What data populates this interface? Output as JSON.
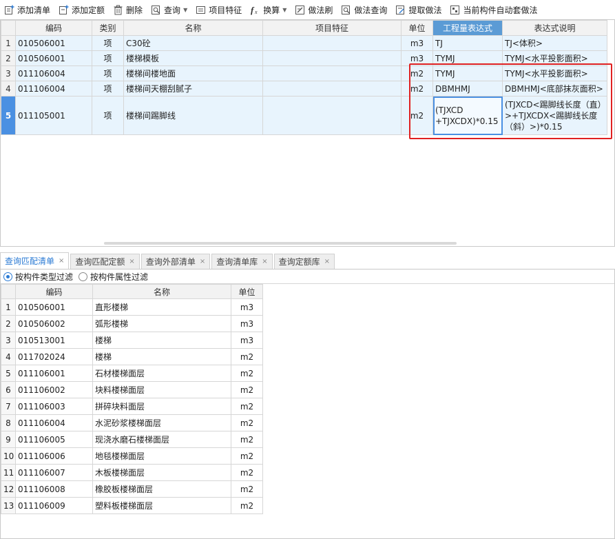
{
  "toolbar": {
    "add_list": "添加清单",
    "add_quota": "添加定额",
    "delete": "删除",
    "query": "查询",
    "item_feature": "项目特征",
    "convert": "换算",
    "method_brush": "做法刷",
    "method_query": "做法查询",
    "extract_method": "提取做法",
    "auto_apply": "当前构件自动套做法"
  },
  "upper_table": {
    "headers": [
      "编码",
      "类别",
      "名称",
      "项目特征",
      "单位",
      "工程量表达式",
      "表达式说明"
    ],
    "rows": [
      {
        "n": "1",
        "code": "010506001",
        "type": "项",
        "name": "C30砼",
        "feature": "",
        "unit": "m3",
        "expr": "TJ",
        "desc": "TJ<体积>"
      },
      {
        "n": "2",
        "code": "010506001",
        "type": "项",
        "name": "楼梯模板",
        "feature": "",
        "unit": "m3",
        "expr": "TYMJ",
        "desc": "TYMJ<水平投影面积>"
      },
      {
        "n": "3",
        "code": "011106004",
        "type": "项",
        "name": "楼梯间楼地面",
        "feature": "",
        "unit": "m2",
        "expr": "TYMJ",
        "desc": "TYMJ<水平投影面积>"
      },
      {
        "n": "4",
        "code": "011106004",
        "type": "项",
        "name": "楼梯间天棚刮腻子",
        "feature": "",
        "unit": "m2",
        "expr": "DBMHMJ",
        "desc": "DBMHMJ<底部抹灰面积>"
      },
      {
        "n": "5",
        "code": "011105001",
        "type": "项",
        "name": "楼梯间踢脚线",
        "feature": "",
        "unit": "m2",
        "expr": "(TJXCD +TJXCDX)*0.15",
        "desc": "(TJXCD<踢脚线长度（直）>+TJXCDX<踢脚线长度（斜）>)*0.15"
      }
    ]
  },
  "tabs": [
    "查询匹配清单",
    "查询匹配定额",
    "查询外部清单",
    "查询清单库",
    "查询定额库"
  ],
  "filters": {
    "by_type": "按构件类型过滤",
    "by_attr": "按构件属性过滤"
  },
  "lower_table": {
    "headers": [
      "编码",
      "名称",
      "单位"
    ],
    "rows": [
      {
        "n": "1",
        "code": "010506001",
        "name": "直形楼梯",
        "unit": "m3"
      },
      {
        "n": "2",
        "code": "010506002",
        "name": "弧形楼梯",
        "unit": "m3"
      },
      {
        "n": "3",
        "code": "010513001",
        "name": "楼梯",
        "unit": "m3"
      },
      {
        "n": "4",
        "code": "011702024",
        "name": "楼梯",
        "unit": "m2"
      },
      {
        "n": "5",
        "code": "011106001",
        "name": "石材楼梯面层",
        "unit": "m2"
      },
      {
        "n": "6",
        "code": "011106002",
        "name": "块料楼梯面层",
        "unit": "m2"
      },
      {
        "n": "7",
        "code": "011106003",
        "name": "拼碎块料面层",
        "unit": "m2"
      },
      {
        "n": "8",
        "code": "011106004",
        "name": "水泥砂浆楼梯面层",
        "unit": "m2"
      },
      {
        "n": "9",
        "code": "011106005",
        "name": "现浇水磨石楼梯面层",
        "unit": "m2"
      },
      {
        "n": "10",
        "code": "011106006",
        "name": "地毯楼梯面层",
        "unit": "m2"
      },
      {
        "n": "11",
        "code": "011106007",
        "name": "木板楼梯面层",
        "unit": "m2"
      },
      {
        "n": "12",
        "code": "011106008",
        "name": "橡胶板楼梯面层",
        "unit": "m2"
      },
      {
        "n": "13",
        "code": "011106009",
        "name": "塑料板楼梯面层",
        "unit": "m2"
      }
    ]
  },
  "colors": {
    "accent": "#4a90e2",
    "highlight_box": "#e02020",
    "row_fill": "#e8f4fd"
  }
}
